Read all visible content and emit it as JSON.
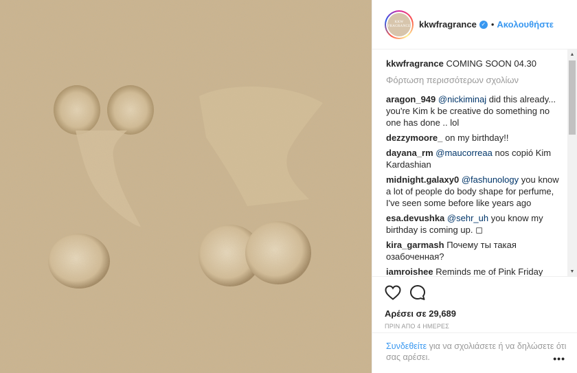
{
  "post": {
    "username": "kkwfragrance",
    "follow_label": "Ακολουθήστε",
    "separator": "•",
    "avatar_text": "KKW FRAGRANCE",
    "caption_text": "COMING SOON 04.30",
    "load_more": "Φόρτωση περισσότερων σχολίων",
    "comments": [
      {
        "user": "aragon_949",
        "mention": "@nickiminaj",
        "text": " did this already... you're Kim k be creative do something no one has done .. lol"
      },
      {
        "user": "dezzymoore_",
        "mention": "",
        "text": "on my birthday!!"
      },
      {
        "user": "dayana_rm",
        "mention": "@maucorreaa",
        "text": " nos copió Kim Kardashian"
      },
      {
        "user": "midnight.galaxy0",
        "mention": "@fashunology",
        "text": " you know a lot of people do body shape for perfume, I've seen some before like years ago"
      },
      {
        "user": "esa.devushka",
        "mention": "@sehr_uh",
        "text": " you know my birthday is coming up. ◻"
      },
      {
        "user": "kira_garmash",
        "mention": "",
        "text": "Почему ты такая озабоченная?"
      },
      {
        "user": "iamroishee",
        "mention": "",
        "text": "Reminds me of Pink Friday perfume by Nicki and the other perfume"
      }
    ],
    "likes": "Αρέσει σε 29,689",
    "time_ago": "ΠΡΙΝ ΑΠΟ 4 ΗΜΕΡΕΣ",
    "login_link": "Συνδεθείτε",
    "login_text": " για να σχολιάσετε ή να δηλώσετε ότι σας αρέσει.",
    "more_icon": "•••"
  },
  "icons": {
    "like": "heart-icon",
    "comment": "comment-icon",
    "verified": "verified-badge-icon",
    "more": "more-options-icon"
  },
  "colors": {
    "link": "#3897f0",
    "mention": "#003569",
    "muted": "#999999",
    "sand": "#cdb58f"
  }
}
